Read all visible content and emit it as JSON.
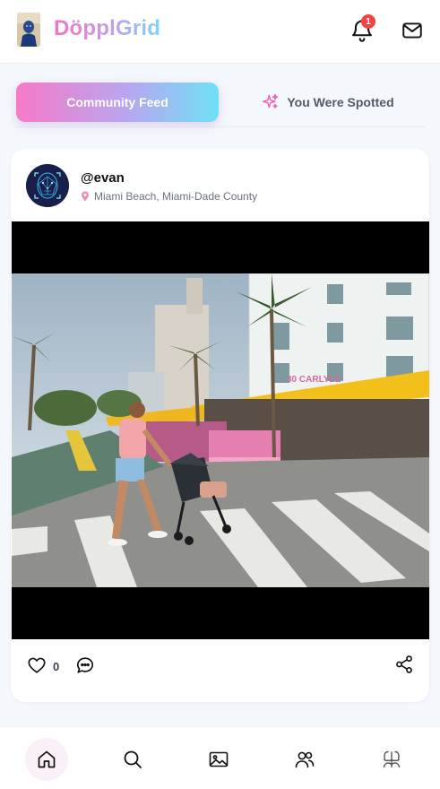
{
  "app": {
    "brand": "DöpplGrid",
    "notifications_count": "1"
  },
  "tabs": [
    {
      "label": "Community Feed",
      "active": true
    },
    {
      "label": "You Were Spotted",
      "active": false
    }
  ],
  "post": {
    "username": "@evan",
    "location": "Miami Beach, Miami-Dade County",
    "likes": "0",
    "photo_sign": "30 CARLYLE"
  },
  "nav": {
    "items": [
      "home-icon",
      "search-icon",
      "image-icon",
      "users-icon",
      "twins-icon"
    ],
    "active": "home-icon"
  },
  "colors": {
    "accent_pink": "#f67ac7",
    "accent_cyan": "#6fe1f6",
    "badge_red": "#ef4444"
  }
}
